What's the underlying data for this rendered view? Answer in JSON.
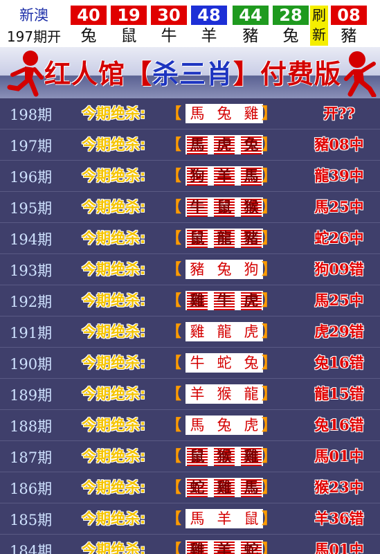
{
  "topbar": {
    "brand": "新澳",
    "issue_label": "197期开",
    "balls": [
      {
        "num": "40",
        "zodiac": "兔",
        "color": "#e00000"
      },
      {
        "num": "19",
        "zodiac": "鼠",
        "color": "#e00000"
      },
      {
        "num": "30",
        "zodiac": "牛",
        "color": "#e00000"
      },
      {
        "num": "48",
        "zodiac": "羊",
        "color": "#1d2fd6"
      },
      {
        "num": "44",
        "zodiac": "豬",
        "color": "#1f9a1f"
      },
      {
        "num": "28",
        "zodiac": "兔",
        "color": "#1f9a1f"
      }
    ],
    "refresh": {
      "top": "刷",
      "bottom": "新",
      "color": "#f5ee00"
    },
    "special": {
      "num": "08",
      "zodiac": "豬",
      "color": "#e00000"
    }
  },
  "banner": {
    "part1": "红人馆【",
    "part2": "杀三肖",
    "part3": "】付费版"
  },
  "rows": [
    {
      "issue": "198期",
      "label": "今期绝杀:",
      "lb": "【",
      "rb": "】",
      "picks": [
        "馬",
        "兔",
        "雞"
      ],
      "hits": [
        false,
        false,
        false
      ],
      "result": "开??"
    },
    {
      "issue": "197期",
      "label": "今期绝杀:",
      "lb": "【",
      "rb": "】",
      "picks": [
        "馬",
        "虎",
        "兔"
      ],
      "hits": [
        true,
        true,
        true
      ],
      "result": "豬08中"
    },
    {
      "issue": "196期",
      "label": "今期绝杀:",
      "lb": "【",
      "rb": "】",
      "picks": [
        "狗",
        "羊",
        "馬"
      ],
      "hits": [
        true,
        true,
        true
      ],
      "result": "龍39中"
    },
    {
      "issue": "195期",
      "label": "今期绝杀:",
      "lb": "【",
      "rb": "】",
      "picks": [
        "牛",
        "鼠",
        "猴"
      ],
      "hits": [
        true,
        true,
        true
      ],
      "result": "馬25中"
    },
    {
      "issue": "194期",
      "label": "今期绝杀:",
      "lb": "【",
      "rb": "】",
      "picks": [
        "鼠",
        "龍",
        "豬"
      ],
      "hits": [
        true,
        true,
        true
      ],
      "result": "蛇26中"
    },
    {
      "issue": "193期",
      "label": "今期绝杀:",
      "lb": "【",
      "rb": "】",
      "picks": [
        "豬",
        "兔",
        "狗"
      ],
      "hits": [
        false,
        false,
        false
      ],
      "result": "狗09错"
    },
    {
      "issue": "192期",
      "label": "今期绝杀:",
      "lb": "【",
      "rb": "】",
      "picks": [
        "雞",
        "牛",
        "虎"
      ],
      "hits": [
        true,
        true,
        true
      ],
      "result": "馬25中"
    },
    {
      "issue": "191期",
      "label": "今期绝杀:",
      "lb": "【",
      "rb": "】",
      "picks": [
        "雞",
        "龍",
        "虎"
      ],
      "hits": [
        false,
        false,
        false
      ],
      "result": "虎29错"
    },
    {
      "issue": "190期",
      "label": "今期绝杀:",
      "lb": "【",
      "rb": "】",
      "picks": [
        "牛",
        "蛇",
        "兔"
      ],
      "hits": [
        false,
        false,
        false
      ],
      "result": "兔16错"
    },
    {
      "issue": "189期",
      "label": "今期绝杀:",
      "lb": "【",
      "rb": "】",
      "picks": [
        "羊",
        "猴",
        "龍"
      ],
      "hits": [
        false,
        false,
        false
      ],
      "result": "龍15错"
    },
    {
      "issue": "188期",
      "label": "今期绝杀:",
      "lb": "【",
      "rb": "】",
      "picks": [
        "馬",
        "兔",
        "虎"
      ],
      "hits": [
        false,
        false,
        false
      ],
      "result": "兔16错"
    },
    {
      "issue": "187期",
      "label": "今期绝杀:",
      "lb": "【",
      "rb": "】",
      "picks": [
        "鼠",
        "猴",
        "雞"
      ],
      "hits": [
        true,
        true,
        true
      ],
      "result": "馬01中"
    },
    {
      "issue": "186期",
      "label": "今期绝杀:",
      "lb": "【",
      "rb": "】",
      "picks": [
        "蛇",
        "雞",
        "馬"
      ],
      "hits": [
        true,
        true,
        true
      ],
      "result": "猴23中"
    },
    {
      "issue": "185期",
      "label": "今期绝杀:",
      "lb": "【",
      "rb": "】",
      "picks": [
        "馬",
        "羊",
        "鼠"
      ],
      "hits": [
        false,
        false,
        false
      ],
      "result": "羊36错"
    },
    {
      "issue": "184期",
      "label": "今期绝杀:",
      "lb": "【",
      "rb": "】",
      "picks": [
        "雞",
        "羊",
        "蛇"
      ],
      "hits": [
        true,
        true,
        true
      ],
      "result": "馬01中"
    }
  ]
}
